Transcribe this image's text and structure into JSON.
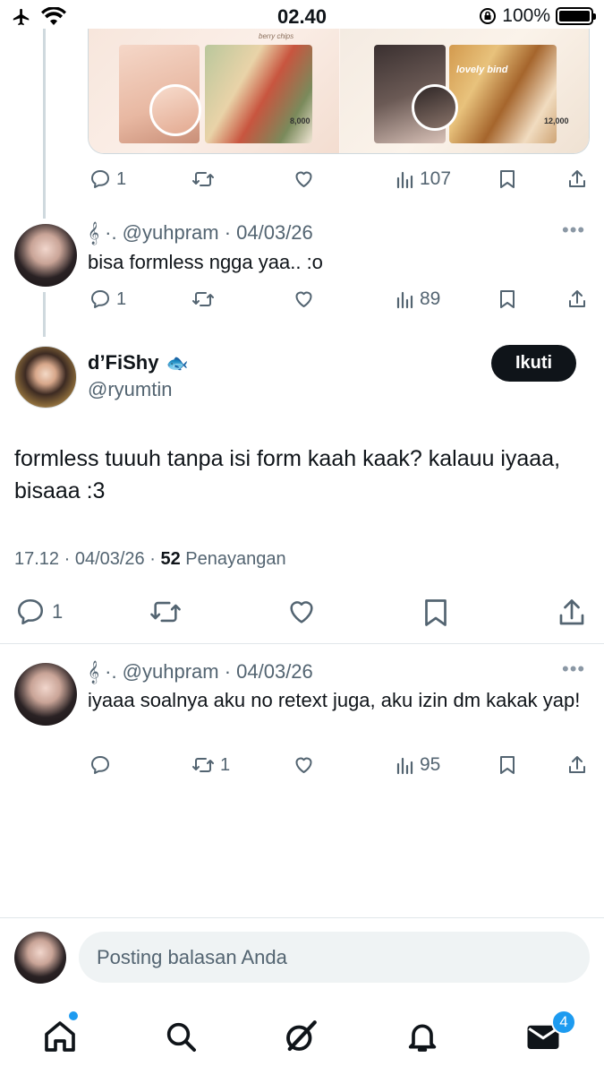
{
  "status_bar": {
    "time": "02.40",
    "battery_percent": "100%"
  },
  "media": {
    "left_caption": "berry chips",
    "left_price": "8,000",
    "right_caption": "lovely bind",
    "right_price": "12,000"
  },
  "tweet1_actions": {
    "replies": "1",
    "views": "107"
  },
  "reply1": {
    "handle": "𝄞 ·. @yuhpram · 04/03/26",
    "text": "bisa formless ngga yaa.. :o",
    "replies": "1",
    "views": "89"
  },
  "main_tweet": {
    "display_name": "d’FiShy",
    "name_emoji": "🐟",
    "handle": "@ryumtin",
    "follow_label": "Ikuti",
    "text": "formless tuuuh tanpa isi form kaah kaak? kalauu iyaaa, bisaaa :3",
    "meta_time": "17.12 · 04/03/26 ·",
    "views_count": "52",
    "views_label": "Penayangan",
    "replies": "1"
  },
  "reply2": {
    "handle": "𝄞 ·. @yuhpram · 04/03/26",
    "text": "iyaaa soalnya aku no retext juga, aku izin dm kakak yap!",
    "retweets": "1",
    "views": "95"
  },
  "composer": {
    "placeholder": "Posting balasan Anda"
  },
  "bottom_nav": {
    "messages_badge": "4"
  }
}
